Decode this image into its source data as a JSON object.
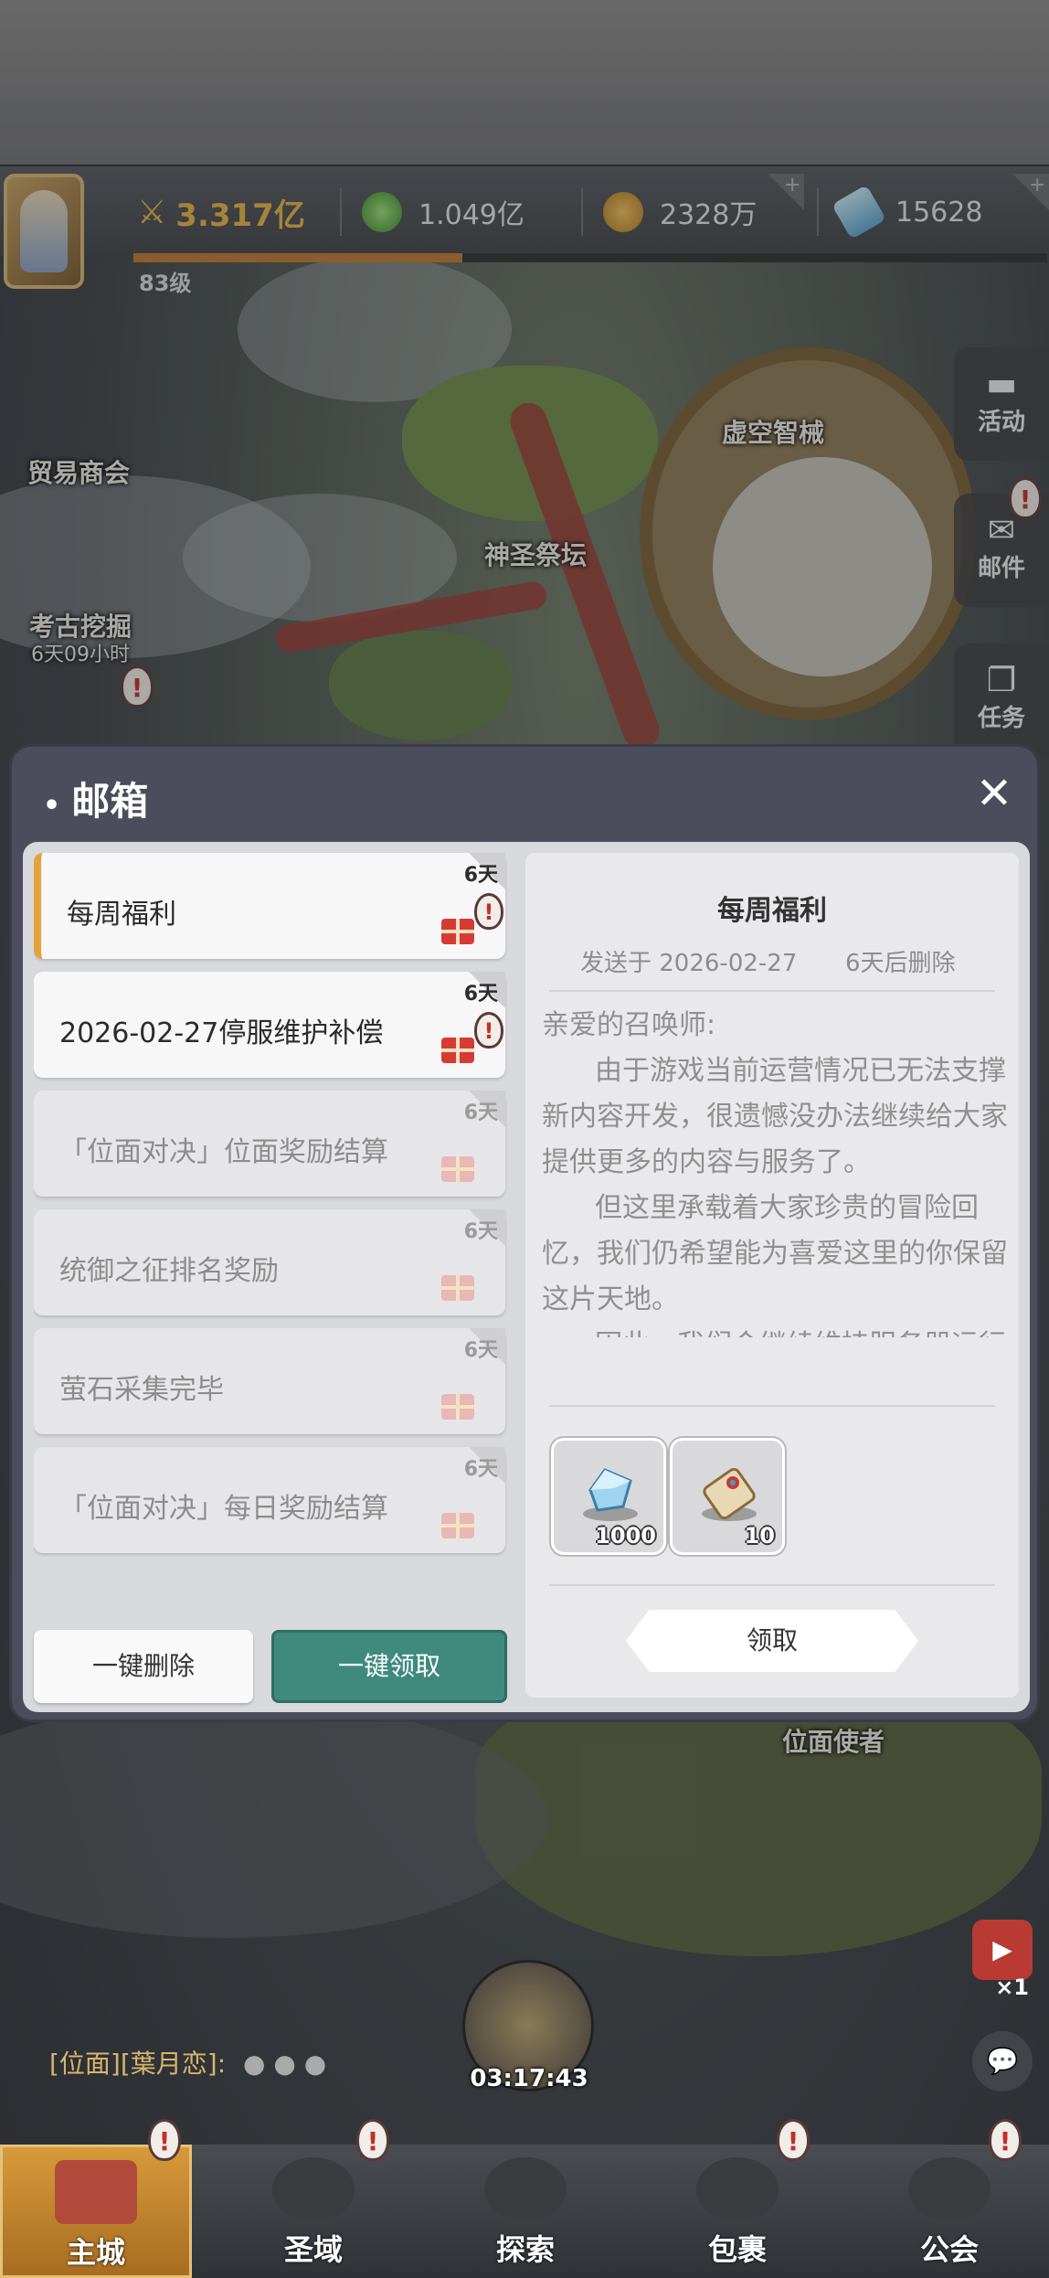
{
  "header": {
    "power": "3.317亿",
    "resources": [
      "1.049亿",
      "2328万",
      "15628"
    ],
    "level": "83级",
    "xp_progress": 0.36
  },
  "map": {
    "labels": {
      "trade": "贸易商会",
      "altar": "神圣祭坛",
      "mecha": "虚空智械",
      "dig": "考古挖掘",
      "dig_timer": "6天09小时",
      "envoy": "位面使者"
    },
    "side_buttons": [
      "活动",
      "邮件",
      "任务"
    ]
  },
  "mailbox": {
    "title": "邮箱",
    "close_icon": "close-icon",
    "mails": [
      {
        "title": "每周福利",
        "days": "6天",
        "state": "selected"
      },
      {
        "title": "2026-02-27停服维护补偿",
        "days": "6天",
        "state": "unread"
      },
      {
        "title": "「位面对决」位面奖励结算",
        "days": "6天",
        "state": "read"
      },
      {
        "title": "统御之征排名奖励",
        "days": "6天",
        "state": "read"
      },
      {
        "title": "萤石采集完毕",
        "days": "6天",
        "state": "read"
      },
      {
        "title": "「位面对决」每日奖励结算",
        "days": "6天",
        "state": "read"
      }
    ],
    "delete_all_label": "一键删除",
    "claim_all_label": "一键领取",
    "detail": {
      "title": "每周福利",
      "sent": "发送于 2026-02-27",
      "expire": "6天后删除",
      "greeting": "亲爱的召唤师:",
      "paragraphs": [
        "由于游戏当前运营情况已无法支撑新内容开发，很遗憾没办法继续给大家提供更多的内容与服务了。",
        "但这里承载着大家珍贵的冒险回忆，我们仍希望能为喜爱这里的你保留这片天地。",
        "因此，我们会继续维持服务器运行(直到无法覆盖服务器成本为止)，"
      ],
      "rewards": [
        {
          "icon": "crystal-icon",
          "count": "1000"
        },
        {
          "icon": "scroll-icon",
          "count": "10"
        }
      ],
      "claim_label": "领取"
    }
  },
  "chat": {
    "text": "[位面][葉月恋]:"
  },
  "timer": "03:17:43",
  "right_buttons": {
    "video_count": "×1"
  },
  "nav": [
    "主城",
    "圣域",
    "探索",
    "包裹",
    "公会"
  ],
  "colors": {
    "accent": "#e3a23a",
    "claim_all": "#3f8a7d",
    "modal": "#4b4d5c"
  }
}
